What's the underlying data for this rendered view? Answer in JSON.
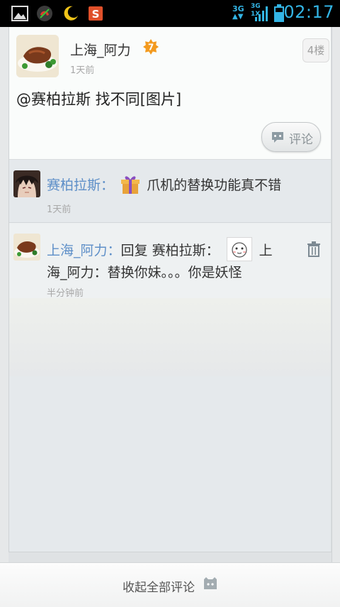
{
  "status_bar": {
    "time": "02:17",
    "network_3g": "3G",
    "network_1x": "3G 1X",
    "icons": [
      "gallery-icon",
      "missed-call-icon",
      "moon-icon",
      "s-app-icon",
      "signal-icon",
      "battery-icon"
    ]
  },
  "floor": {
    "username": "上海_阿力",
    "level": "7",
    "time": "1天前",
    "floor_label": "4楼",
    "content": "@赛柏拉斯 找不同[图片]",
    "comment_button": "评论"
  },
  "replies": [
    {
      "username": "赛柏拉斯",
      "separator": "：",
      "text": "爪机的替换功能真不错",
      "time": "1天前",
      "emoji": "gift-icon"
    },
    {
      "username": "上海_阿力",
      "separator": "：",
      "reply_prefix": "回复 赛柏拉斯：",
      "text_line1_tail": "上",
      "text_line2": "海_阿力：替换你妹。。。你是妖怪",
      "time": "半分钟前",
      "emoji": "cartoon-face-icon"
    }
  ],
  "bottom": {
    "collapse_label": "收起全部评论"
  },
  "colors": {
    "name_link": "#5e8fc8",
    "time_accent": "#33b5e5",
    "level_badge": "#f39a1e"
  }
}
